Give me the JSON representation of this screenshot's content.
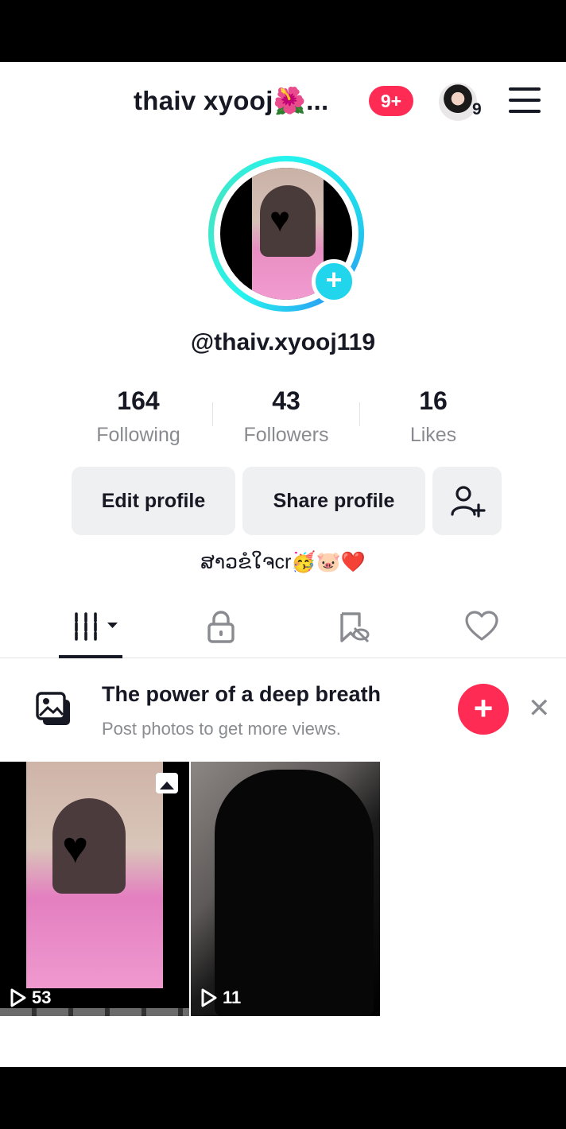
{
  "header": {
    "username": "thaiv xyooj🌺...",
    "notifications": "9+",
    "account_count": "9"
  },
  "profile": {
    "handle": "@thaiv.xyooj119",
    "bio": "ສາວຂໍໃຈcr🥳🐷❤️"
  },
  "stats": [
    {
      "value": "164",
      "label": "Following"
    },
    {
      "value": "43",
      "label": "Followers"
    },
    {
      "value": "16",
      "label": "Likes"
    }
  ],
  "actions": {
    "edit_profile": "Edit profile",
    "share_profile": "Share profile"
  },
  "tabs": [
    "videos-grid",
    "private",
    "reposts-hidden",
    "liked"
  ],
  "banner": {
    "title": "The power of a deep breath",
    "subtitle": "Post photos to get more views."
  },
  "posts": [
    {
      "views": "53",
      "type": "photo"
    },
    {
      "views": "11",
      "type": "video"
    }
  ],
  "colors": {
    "accent": "#fe2c55",
    "ring": "#20d5ec",
    "text": "#161823",
    "muted": "#8a8b91"
  }
}
